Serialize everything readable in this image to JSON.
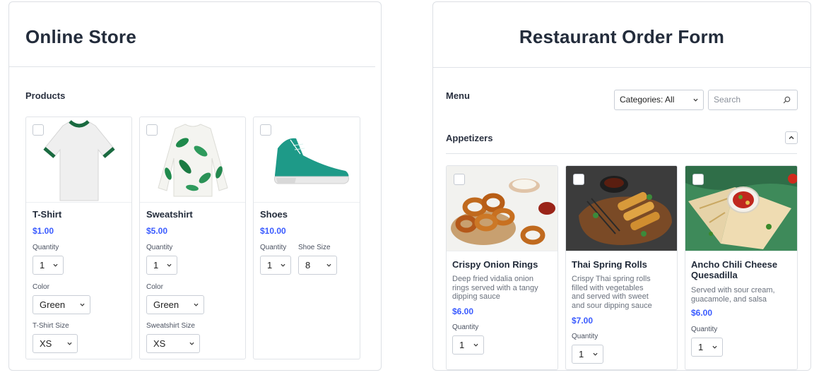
{
  "store": {
    "title": "Online Store",
    "section_label": "Products",
    "products": [
      {
        "name": "T-Shirt",
        "price": "$1.00",
        "quantity_label": "Quantity",
        "quantity": "1",
        "color_label": "Color",
        "color": "Green",
        "size_label": "T-Shirt Size",
        "size": "XS"
      },
      {
        "name": "Sweatshirt",
        "price": "$5.00",
        "quantity_label": "Quantity",
        "quantity": "1",
        "color_label": "Color",
        "color": "Green",
        "size_label": "Sweatshirt Size",
        "size": "XS"
      },
      {
        "name": "Shoes",
        "price": "$10.00",
        "quantity_label": "Quantity",
        "quantity": "1",
        "shoe_size_label": "Shoe Size",
        "shoe_size": "8"
      }
    ]
  },
  "restaurant": {
    "title": "Restaurant Order Form",
    "menu_label": "Menu",
    "category_select": "Categories: All",
    "search_placeholder": "Search",
    "section_title": "Appetizers",
    "items": [
      {
        "name": "Crispy Onion Rings",
        "desc_lines": [
          "Deep fried vidalia onion",
          "rings served with a tangy",
          "dipping sauce"
        ],
        "price": "$6.00",
        "quantity_label": "Quantity",
        "quantity": "1"
      },
      {
        "name": "Thai Spring Rolls",
        "desc_lines": [
          "Crispy Thai spring rolls",
          "filled with vegetables",
          "and served with sweet",
          "and sour dipping sauce"
        ],
        "price": "$7.00",
        "quantity_label": "Quantity",
        "quantity": "1"
      },
      {
        "name_lines": [
          "Ancho Chili Cheese",
          "Quesadilla"
        ],
        "desc_lines": [
          "Served with sour cream,",
          "guacamole, and salsa"
        ],
        "price": "$6.00",
        "quantity_label": "Quantity",
        "quantity": "1"
      }
    ]
  },
  "colors": {
    "accent": "#3a5bff",
    "border": "#dcdfe4",
    "text": "#222b3a",
    "tshirt_trim": "#1a6a40",
    "leaf_green": "#1f8a4c",
    "shoe_teal": "#1e9a88"
  },
  "icons": {
    "caret": "chevron-down-icon",
    "search": "search-icon",
    "collapse": "chevron-up-icon"
  }
}
